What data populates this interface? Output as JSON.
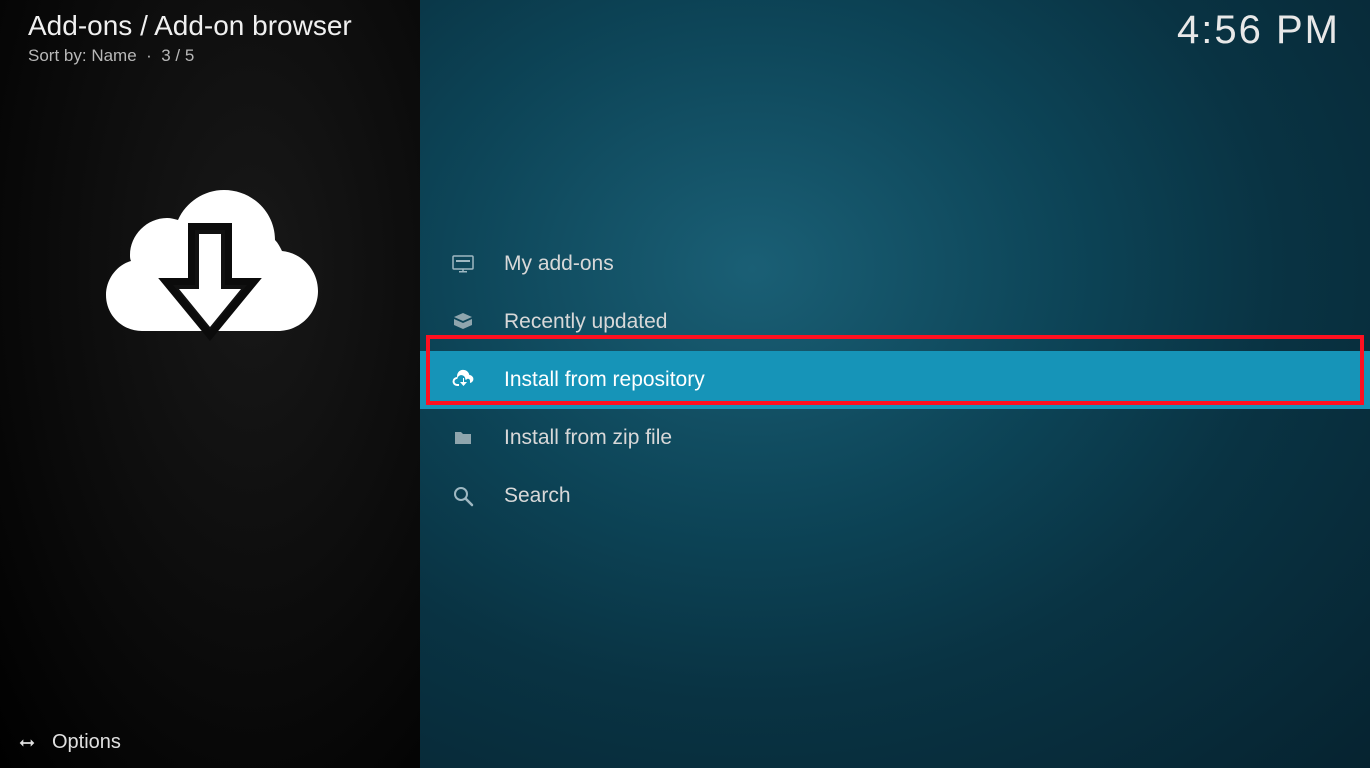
{
  "header": {
    "breadcrumb": "Add-ons / Add-on browser",
    "sort_prefix": "Sort by: ",
    "sort_value": "Name",
    "position": "3 / 5",
    "clock": "4:56 PM"
  },
  "sidebar": {
    "icon": "download-cloud-icon",
    "options_label": "Options"
  },
  "menu": {
    "items": [
      {
        "label": "My add-ons",
        "icon": "monitor-icon",
        "selected": false
      },
      {
        "label": "Recently updated",
        "icon": "open-box-icon",
        "selected": false
      },
      {
        "label": "Install from repository",
        "icon": "cloud-download-icon",
        "selected": true
      },
      {
        "label": "Install from zip file",
        "icon": "zip-file-icon",
        "selected": false
      },
      {
        "label": "Search",
        "icon": "search-icon",
        "selected": false
      }
    ]
  },
  "highlight": {
    "target_index": 2
  }
}
